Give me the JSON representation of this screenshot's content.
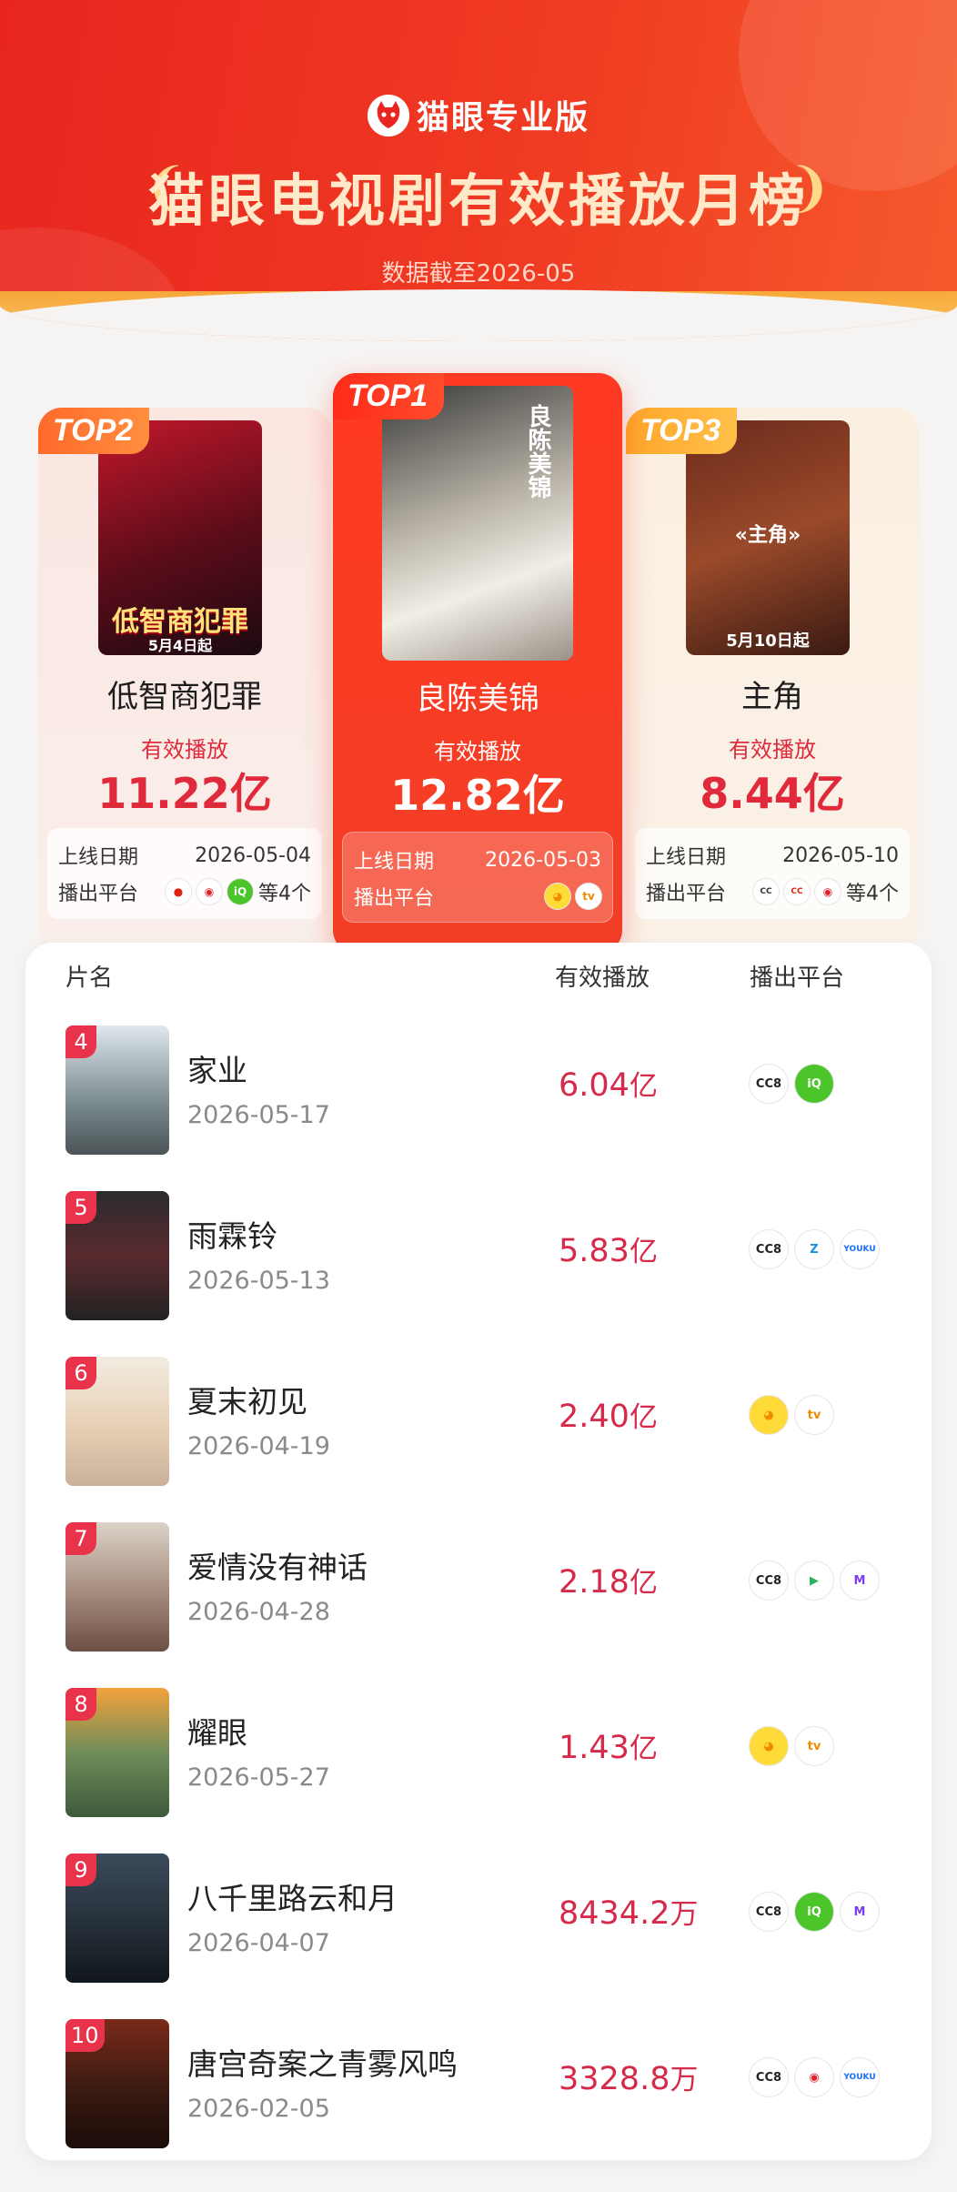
{
  "header": {
    "brand": "猫眼专业版",
    "title": "猫眼电视剧有效播放月榜",
    "subtitle": "数据截至2026-05"
  },
  "labels": {
    "effective_play": "有效播放",
    "launch_date": "上线日期",
    "platform": "播出平台",
    "col_name": "片名",
    "col_play": "有效播放",
    "col_platform": "播出平台"
  },
  "top": [
    {
      "tag": "TOP1",
      "name": "良陈美锦",
      "value": "12.82亿",
      "date": "2026-05-03",
      "poster_text": "良陈美锦",
      "platforms": [
        "mango-icon",
        "mgtv-icon"
      ],
      "more": ""
    },
    {
      "tag": "TOP2",
      "name": "低智商犯罪",
      "value": "11.22亿",
      "date": "2026-05-04",
      "poster_text": "低智商犯罪",
      "poster_date": "5月4日起",
      "platforms": [
        "cctv-icon",
        "tencent-icon",
        "iqiyi-icon"
      ],
      "more": "等4个"
    },
    {
      "tag": "TOP3",
      "name": "主角",
      "value": "8.44亿",
      "date": "2026-05-10",
      "poster_text": "«主角»",
      "poster_date": "5月10日起",
      "platforms": [
        "cctv-icon",
        "cctv-icon",
        "tencent-icon"
      ],
      "more": "等4个"
    }
  ],
  "list": [
    {
      "rank": "4",
      "name": "家业",
      "date": "2026-05-17",
      "value": "6.04",
      "unit": "亿",
      "platforms": [
        "cctv8-icon",
        "iqiyi-icon"
      ]
    },
    {
      "rank": "5",
      "name": "雨霖铃",
      "date": "2026-05-13",
      "value": "5.83",
      "unit": "亿",
      "platforms": [
        "cctv8-icon",
        "zj-tv-icon",
        "youku-icon"
      ]
    },
    {
      "rank": "6",
      "name": "夏末初见",
      "date": "2026-04-19",
      "value": "2.40",
      "unit": "亿",
      "platforms": [
        "mango-icon",
        "mgtv-icon"
      ]
    },
    {
      "rank": "7",
      "name": "爱情没有神话",
      "date": "2026-04-28",
      "value": "2.18",
      "unit": "亿",
      "platforms": [
        "cctv8-icon",
        "tencent-video-icon",
        "migu-icon"
      ]
    },
    {
      "rank": "8",
      "name": "耀眼",
      "date": "2026-05-27",
      "value": "1.43",
      "unit": "亿",
      "platforms": [
        "mango-icon",
        "mgtv-icon"
      ]
    },
    {
      "rank": "9",
      "name": "八千里路云和月",
      "date": "2026-04-07",
      "value": "8434.2",
      "unit": "万",
      "platforms": [
        "cctv8-icon",
        "iqiyi-icon",
        "migu-icon"
      ]
    },
    {
      "rank": "10",
      "name": "唐宫奇案之青雾风鸣",
      "date": "2026-02-05",
      "value": "3328.8",
      "unit": "万",
      "platforms": [
        "cctv8-icon",
        "tencent-icon",
        "youku-icon"
      ]
    }
  ],
  "colors": {
    "brand_red": "#e8261f",
    "value_red": "#d62a4a",
    "gold": "#ffd98a"
  }
}
